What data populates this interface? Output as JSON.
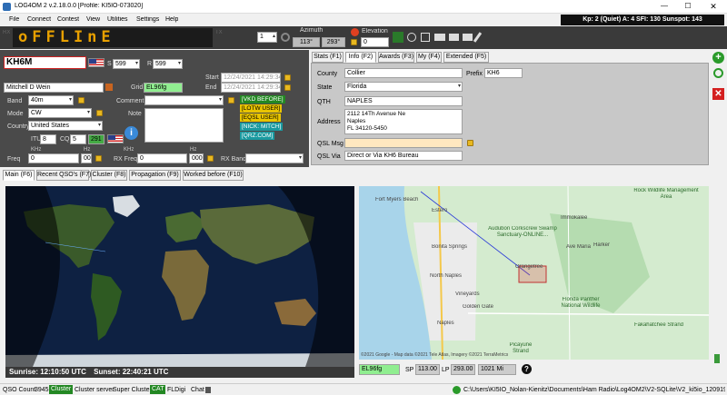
{
  "titlebar": {
    "title": "LOG4OM 2 v.2.18.0.0 [Profile: KI5IO-073020]"
  },
  "menu": [
    "File",
    "Connect",
    "Contest",
    "View",
    "Utilities",
    "Settings",
    "Help"
  ],
  "propagation": "Kp: 2 (Quiet)  A: 4  SFI: 130 Sunspot: 143",
  "toolbar": {
    "display": "oFFLInE",
    "side_left": "RX",
    "side_right": "TX",
    "stepper": "1",
    "azimuth_label": "Azimuth",
    "azimuth_short": "113°",
    "azimuth_long": "293°",
    "elevation_label": "Elevation",
    "elevation_value": "0"
  },
  "qso": {
    "callsign": "KH6M",
    "s_label": "S",
    "s_value": "599",
    "r_label": "R",
    "r_value": "599",
    "name": "Mitchell D Wein",
    "grid_label": "Grid",
    "grid": "EL96fg",
    "start_label": "Start",
    "start": "12/24/2021 14:29:34",
    "end_label": "End",
    "end": "12/24/2021 14:29:34",
    "band_label": "Band",
    "band": "40m",
    "mode_label": "Mode",
    "mode": "CW",
    "country_label": "Country",
    "country": "United States",
    "itu_label": "ITU",
    "itu": "8",
    "cq_label": "CQ",
    "cq": "5",
    "dxcc": "291",
    "comment_label": "Comment",
    "note_label": "Note",
    "freq_label": "Freq",
    "khz": "KHz",
    "hz": "Hz",
    "freq_khz": "0",
    "freq_hz": "000",
    "rxfreq_label": "RX Freq",
    "rxfreq_khz": "0",
    "rxfreq_hz": "000",
    "rxband_label": "RX Band",
    "badges": [
      "[VKD BEFORE]",
      "[LOTW USER]",
      "[EQSL USER]",
      "[NICK: MITCH]",
      "[QRZ.COM]"
    ]
  },
  "info_tabs": [
    "Stats (F1)",
    "Info (F2)",
    "Awards (F3)",
    "My (F4)",
    "Extended (F5)"
  ],
  "info": {
    "county_label": "County",
    "county": "Collier",
    "prefix_label": "Prefix",
    "prefix": "KH6",
    "state_label": "State",
    "state": "Florida",
    "qth_label": "QTH",
    "qth": "NAPLES",
    "address_label": "Address",
    "address": [
      "2112 14Th Avenue Ne",
      "Naples",
      "FL 34120-5450"
    ],
    "qslmsg_label": "QSL Msg",
    "qslvia_label": "QSL Via",
    "qslvia": "Direct or Via KH6 Bureau"
  },
  "main_tabs": [
    "Main (F6)",
    "Recent QSO's (F7)",
    "Cluster (F8)",
    "Propagation (F9)",
    "Worked before (F10)"
  ],
  "world": {
    "sunrise": "Sunrise: 12:10:50 UTC",
    "sunset": "Sunset: 22:40:21 UTC"
  },
  "map": {
    "labels": [
      "Fort Myers Beach",
      "Estero",
      "Immokalee",
      "Bonita Springs",
      "North Naples",
      "Vineyards",
      "Golden Gate",
      "Naples",
      "Orangetree",
      "Ave Maria",
      "Harker",
      "Audubon Corkscrew Swamp Sanctuary-ONLINE...",
      "Florida Panther National Wildlife",
      "Picayune Strand",
      "Fakahatchee Strand",
      "Rock Wildlife Management Area"
    ],
    "copyright": "©2021 Google - Map data ©2021 Tele Atlas, Imagery ©2021 TerraMetrics",
    "grid": "EL96fg",
    "sp_label": "SP",
    "sp": "113.00",
    "lp_label": "LP",
    "lp": "293.00",
    "distance": "1021 Mi"
  },
  "status": {
    "qso_count_label": "QSO Count",
    "qso_count": "3945",
    "items": [
      "Cluster",
      "Cluster server",
      "Super Cluster",
      "CAT",
      "FLDigi",
      "Chat"
    ],
    "path": "C:\\Users\\KI5IO_Nolan-Kienitz\\Documents\\Ham Radio\\Log4OM2\\V2-SQLite\\V2_ki5io_120919.SQLite"
  }
}
